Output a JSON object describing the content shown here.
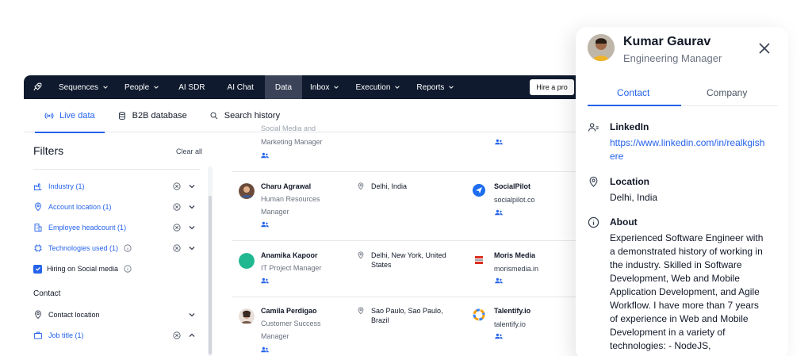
{
  "nav": {
    "items": [
      {
        "label": "Sequences",
        "dropdown": true
      },
      {
        "label": "People",
        "dropdown": true
      },
      {
        "label": "AI SDR",
        "dropdown": false
      },
      {
        "label": "AI Chat",
        "dropdown": false
      },
      {
        "label": "Data",
        "dropdown": false,
        "active": true
      },
      {
        "label": "Inbox",
        "dropdown": true
      },
      {
        "label": "Execution",
        "dropdown": true
      },
      {
        "label": "Reports",
        "dropdown": true
      }
    ],
    "hire_label": "Hire a pro"
  },
  "subnav": {
    "live_data": "Live data",
    "b2b_database": "B2B database",
    "search_history": "Search history"
  },
  "filters": {
    "title": "Filters",
    "clear_all": "Clear all",
    "industry": "Industry (1)",
    "account_location": "Account location (1)",
    "employee_headcount": "Employee headcount (1)",
    "technologies_used": "Technologies used (1)",
    "hiring_social": "Hiring on Social media",
    "contact_section": "Contact",
    "contact_location": "Contact location",
    "job_title": "Job title (1)"
  },
  "results": {
    "partial_top": {
      "title": "Social Media and Marketing Manager",
      "title_line2": "Marketing Manager"
    },
    "rows": [
      {
        "name": "Charu Agrawal",
        "title": "Human Resources Manager",
        "location": "Delhi, India",
        "company": "SocialPilot",
        "domain": "socialpilot.co"
      },
      {
        "name": "Anamika Kapoor",
        "title": "IT Project Manager",
        "location": "Delhi, New York, United States",
        "company": "Moris Media",
        "domain": "morismedia.in"
      },
      {
        "name": "Camila Perdigao",
        "title": "Customer Success Manager",
        "location": "Sao Paulo, Sao Paulo, Brazil",
        "company": "Talentify.io",
        "domain": "talentify.io"
      }
    ]
  },
  "panel": {
    "name": "Kumar Gaurav",
    "role": "Engineering Manager",
    "tabs": {
      "contact": "Contact",
      "company": "Company"
    },
    "linkedin_title": "LinkedIn",
    "linkedin_url": "https://www.linkedin.com/in/realkgishere",
    "location_title": "Location",
    "location_value": "Delhi, India",
    "about_title": "About",
    "about_text": "Experienced Software Engineer with a demonstrated history of working in the industry. Skilled in Software Development, Web and Mobile Application Development, and Agile Workflow. I have more than 7 years of experience in Web and Mobile Development in a variety of technologies: - NodeJS,"
  },
  "colors": {
    "nav_bg": "#0f1a2e",
    "accent": "#2563eb",
    "nav_active": "#3a4357"
  },
  "icons": [
    "rocket-icon",
    "chevron-down-icon",
    "broadcast-icon",
    "database-icon",
    "search-icon",
    "industry-icon",
    "location-pin-icon",
    "building-icon",
    "chip-icon",
    "info-icon",
    "x-circle-icon",
    "chevron-up-icon",
    "briefcase-icon",
    "people-icon",
    "close-icon",
    "linkedin-user-icon"
  ]
}
